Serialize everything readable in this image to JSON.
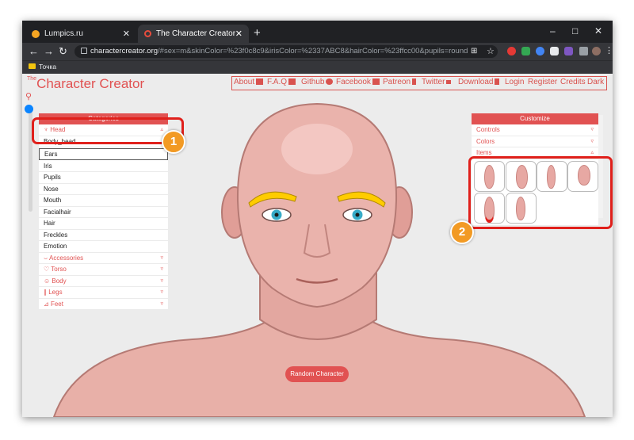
{
  "browser": {
    "tabs": [
      {
        "title": "Lumpics.ru",
        "close": "✕"
      },
      {
        "title": "The Character Creator - Build visual characters",
        "close": "✕"
      }
    ],
    "new_tab": "+",
    "window_controls": {
      "minimize": "–",
      "maximize": "□",
      "close": "✕"
    },
    "url_domain": "charactercreator.org",
    "url_rest": "/#sex=m&skinColor=%23f0c8c9&irisColor=%2337ABC8&hairColor=%23ffcc00&pupils=round",
    "bookmark": "Точка"
  },
  "site": {
    "logo_prefix": "The",
    "logo": "Character Creator",
    "menu": [
      "About",
      "F.A.Q",
      "Github",
      "Facebook",
      "Patreon",
      "Twitter",
      "Download",
      "Login",
      "Register",
      "Credits",
      "Dark"
    ]
  },
  "categories": {
    "title": "Categories",
    "head_label": "Head",
    "items": [
      "Body_head",
      "Ears",
      "Iris",
      "Pupils",
      "Nose",
      "Mouth",
      "Facialhair",
      "Hair",
      "Freckles",
      "Emotion"
    ],
    "groups": [
      "Accessories",
      "Torso",
      "Body",
      "Legs",
      "Feet"
    ]
  },
  "customize": {
    "title": "Customize",
    "rows": [
      "Controls",
      "Colors",
      "Items"
    ]
  },
  "random_button": "Random Character",
  "annotations": {
    "badge1": "1",
    "badge2": "2"
  },
  "colors": {
    "accent": "#e15252",
    "highlight": "#e0201b",
    "badge": "#f29a24",
    "hair": "#ffcc00",
    "iris": "#37abc8",
    "skin": "#f0c8c9"
  }
}
